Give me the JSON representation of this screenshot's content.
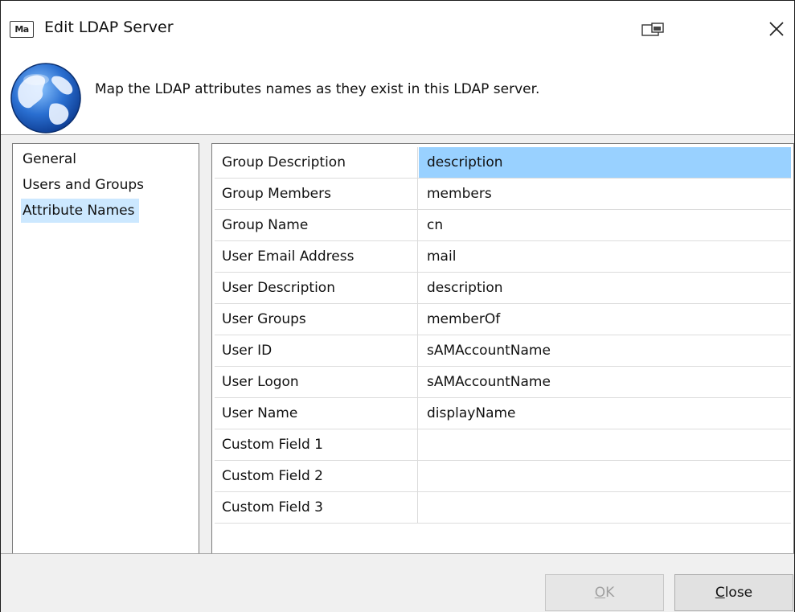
{
  "window": {
    "app_icon_text": "Ma",
    "title": "Edit LDAP Server"
  },
  "header": {
    "message": "Map the LDAP attributes names as they exist in this LDAP server."
  },
  "nav": {
    "items": [
      {
        "label": "General"
      },
      {
        "label": "Users and Groups"
      },
      {
        "label": "Attribute Names",
        "selected": true
      }
    ]
  },
  "attributes": {
    "rows": [
      {
        "name": "Group Description",
        "value": "description",
        "selected": true
      },
      {
        "name": "Group Members",
        "value": "members"
      },
      {
        "name": "Group Name",
        "value": "cn"
      },
      {
        "name": "User Email Address",
        "value": "mail"
      },
      {
        "name": "User Description",
        "value": "description"
      },
      {
        "name": "User Groups",
        "value": "memberOf"
      },
      {
        "name": "User ID",
        "value": "sAMAccountName"
      },
      {
        "name": "User Logon",
        "value": "sAMAccountName"
      },
      {
        "name": "User Name",
        "value": "displayName"
      },
      {
        "name": "Custom Field 1",
        "value": ""
      },
      {
        "name": "Custom Field 2",
        "value": ""
      },
      {
        "name": "Custom Field 3",
        "value": ""
      }
    ]
  },
  "buttons": {
    "ok_label": "OK",
    "ok_enabled": false,
    "close_label": "Close"
  },
  "colors": {
    "selection_nav": "#cce8ff",
    "selection_cell": "#99d1ff",
    "dialog_bg": "#f0f0f0"
  },
  "icons": {
    "app": "ma-app-icon",
    "restore": "restore-window-icon",
    "close": "close-icon",
    "header": "globe-icon"
  }
}
